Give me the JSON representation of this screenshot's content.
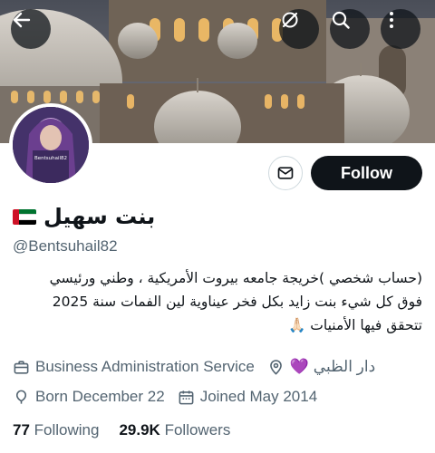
{
  "header": {
    "back_icon": "arrow-left-icon",
    "grok_icon": "slash-circle-icon",
    "search_icon": "search-icon",
    "more_icon": "more-vertical-icon"
  },
  "profile": {
    "display_name": "بنت سهيل",
    "flag": "uae-flag-icon",
    "handle": "@Bentsuhail82",
    "avatar_caption": "Bentsuhail82",
    "follow_label": "Follow",
    "message_icon": "envelope-icon",
    "bio_lines": [
      "(حساب شخصي )خريجة جامعه بيروت الأمريكية ، وطني ورئيسي",
      "فوق كل شيء بنت زايد بكل فخر عيناوية لين الفمات سنة 2025",
      "تتحقق فيها الأمنيات 🙏🏻"
    ],
    "category": "Business Administration Service",
    "location": "دار الظبي 💜",
    "born": "Born December 22",
    "joined": "Joined May 2014",
    "following_count": "77",
    "following_label": "Following",
    "followers_count": "29.9K",
    "followers_label": "Followers"
  },
  "colors": {
    "text_primary": "#0f1419",
    "text_secondary": "#536471",
    "follow_bg": "#0f1419",
    "border": "#cfd9de"
  }
}
